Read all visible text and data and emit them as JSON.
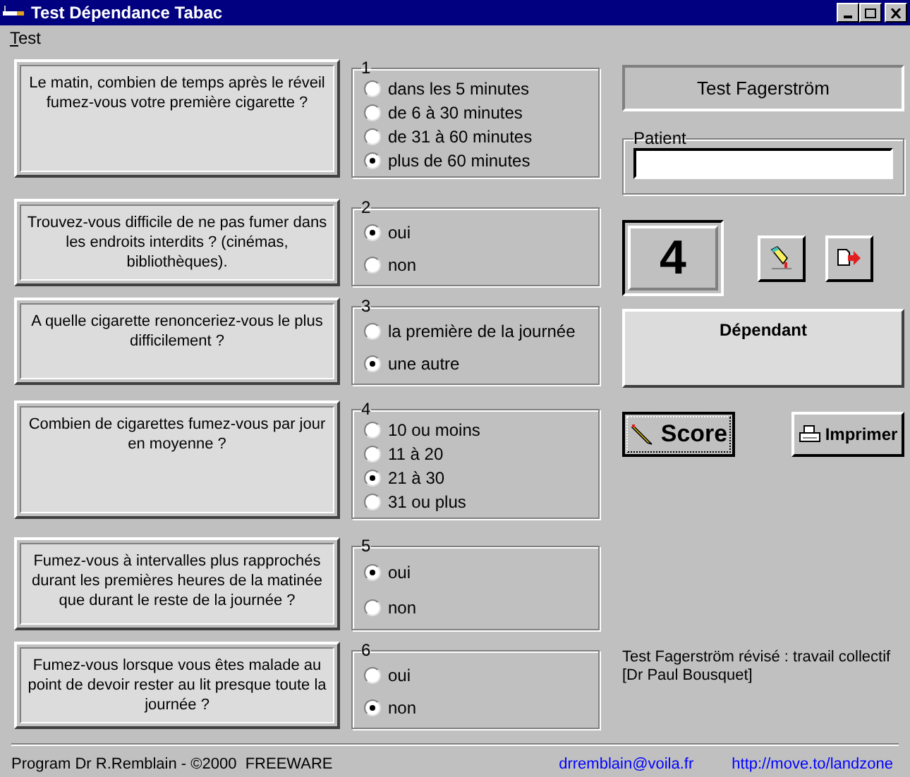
{
  "window": {
    "title": "Test Dépendance Tabac"
  },
  "menu": [
    "Test"
  ],
  "questions": [
    {
      "number": "1",
      "text": "Le matin, combien de temps après le réveil fumez-vous votre première cigarette ?",
      "options": [
        {
          "label": "dans les 5 minutes",
          "selected": false
        },
        {
          "label": "de 6 à 30 minutes",
          "selected": false
        },
        {
          "label": "de 31 à 60 minutes",
          "selected": false
        },
        {
          "label": "plus de 60 minutes",
          "selected": true
        }
      ]
    },
    {
      "number": "2",
      "text": "Trouvez-vous difficile de ne pas fumer dans les endroits interdits ? (cinémas, bibliothèques).",
      "options": [
        {
          "label": "oui",
          "selected": true
        },
        {
          "label": "non",
          "selected": false
        }
      ]
    },
    {
      "number": "3",
      "text": "A quelle cigarette renonceriez-vous le plus difficilement ?",
      "options": [
        {
          "label": "la première de la journée",
          "selected": false
        },
        {
          "label": "une autre",
          "selected": true
        }
      ]
    },
    {
      "number": "4",
      "text": "Combien de cigarettes fumez-vous par jour en moyenne ?",
      "options": [
        {
          "label": "10 ou moins",
          "selected": false
        },
        {
          "label": "11 à 20",
          "selected": false
        },
        {
          "label": "21 à 30",
          "selected": true
        },
        {
          "label": "31 ou plus",
          "selected": false
        }
      ]
    },
    {
      "number": "5",
      "text": "Fumez-vous à intervalles plus rapprochés durant les premières heures de la matinée que durant le reste de la journée ?",
      "options": [
        {
          "label": "oui",
          "selected": true
        },
        {
          "label": "non",
          "selected": false
        }
      ]
    },
    {
      "number": "6",
      "text": "Fumez-vous lorsque vous êtes malade au point de devoir rester au lit presque toute la journée ?",
      "options": [
        {
          "label": "oui",
          "selected": false
        },
        {
          "label": "non",
          "selected": true
        }
      ]
    }
  ],
  "test_name": "Test Fagerström",
  "patient": {
    "label": "Patient"
  },
  "score": "4",
  "result": "Dépendant",
  "buttons": {
    "score": "Score",
    "print": "Imprimer"
  },
  "credit": [
    "Test Fagerström révisé : travail collectif",
    "[Dr Paul Bousquet]"
  ],
  "footer": {
    "text": "Program Dr R.Remblain - ©2000  FREEWARE",
    "email": "drremblain@voila.fr",
    "url": "http://move.to/landzone"
  }
}
